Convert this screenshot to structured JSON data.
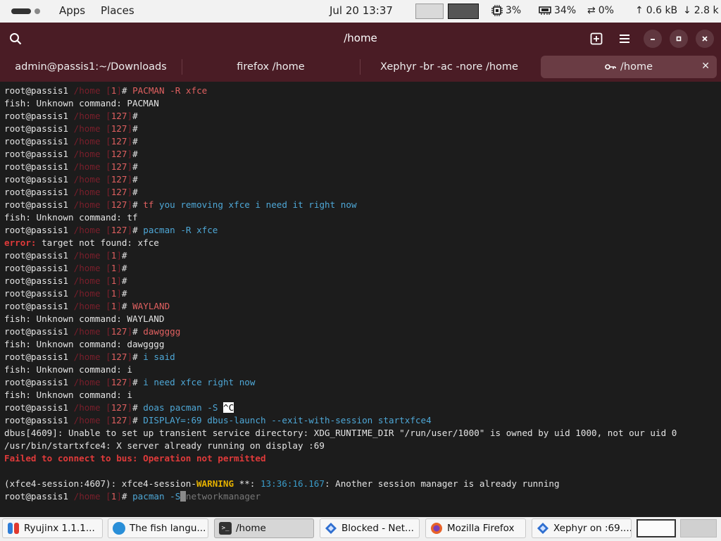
{
  "top_panel": {
    "apps_label": "Apps",
    "places_label": "Places",
    "clock": "Jul 20  13:37",
    "cpu": "3%",
    "mem": "34%",
    "swap": "0%",
    "net_up": "0.6 kB",
    "net_down": "2.8 k"
  },
  "window": {
    "title": "/home",
    "tabs": [
      {
        "label": "admin@passis1:~/Downloads"
      },
      {
        "label": "firefox /home"
      },
      {
        "label": "Xephyr -br -ac -nore /home"
      },
      {
        "label": "/home"
      }
    ]
  },
  "terminal": {
    "user": "root",
    "host": "@passis1",
    "cwd": "/home",
    "lines": [
      {
        "status": "1",
        "cmd": "PACMAN -R xfce"
      },
      {
        "out": "fish: Unknown command: PACMAN"
      },
      {
        "status": "127",
        "cmd": ""
      },
      {
        "status": "127",
        "cmd": ""
      },
      {
        "status": "127",
        "cmd": ""
      },
      {
        "status": "127",
        "cmd": ""
      },
      {
        "status": "127",
        "cmd": ""
      },
      {
        "status": "127",
        "cmd": ""
      },
      {
        "status": "127",
        "cmd": ""
      },
      {
        "status": "127",
        "cmd_word": "tf",
        "cmd_rest": " you removing xfce i need it right now"
      },
      {
        "out": "fish: Unknown command: tf"
      },
      {
        "status": "127",
        "cmd_word": "pacman",
        "cmd_rest": " -R xfce"
      },
      {
        "err_label": "error:",
        "out": " target not found: xfce"
      },
      {
        "status": "1",
        "cmd": ""
      },
      {
        "status": "1",
        "cmd": ""
      },
      {
        "status": "1",
        "cmd": ""
      },
      {
        "status": "1",
        "cmd": ""
      },
      {
        "status": "1",
        "cmd": "WAYLAND"
      },
      {
        "out": "fish: Unknown command: WAYLAND"
      },
      {
        "status": "127",
        "cmd": "dawgggg"
      },
      {
        "out": "fish: Unknown command: dawgggg"
      },
      {
        "status": "127",
        "cmd_word": "i",
        "cmd_rest": " said"
      },
      {
        "out": "fish: Unknown command: i"
      },
      {
        "status": "127",
        "cmd_word": "i",
        "cmd_rest": " need xfce right now"
      },
      {
        "out": "fish: Unknown command: i"
      },
      {
        "status": "127",
        "cmd_word": "doas",
        "cmd_rest": " pacman -S ",
        "ctrl": "^C"
      },
      {
        "status": "127",
        "cmd_word": "DISPLAY=:69",
        "cmd_rest": " dbus-launch --exit-with-session startxfce4"
      },
      {
        "out": "dbus[4609]: Unable to set up transient service directory: XDG_RUNTIME_DIR \"/run/user/1000\" is owned by uid 1000, not our uid 0"
      },
      {
        "out": "/usr/bin/startxfce4: X server already running on display :69"
      },
      {
        "fatal": "Failed to connect to bus: Operation not permitted"
      },
      {
        "out": ""
      },
      {
        "warn_pre": "(xfce4-session:4607): xfce4-session-",
        "warn": "WARNING",
        "warn_mid": " **: ",
        "warn_ts": "13:36:16.167",
        "warn_post": ": Another session manager is already running"
      },
      {
        "status": "1",
        "cmd_word": "pacman",
        "cmd_rest": " -S",
        "suggestion": "networkmanager"
      }
    ]
  },
  "taskbar": {
    "items": [
      {
        "label": "Ryujinx 1.1.1...",
        "icon": "ryujinx-icon",
        "color": "#2e7dd7"
      },
      {
        "label": "The fish langu...",
        "icon": "globe-icon",
        "color": "#2a8fd8"
      },
      {
        "label": "/home",
        "icon": "terminal-icon",
        "color": "#333333",
        "active": true
      },
      {
        "label": "Blocked - Net...",
        "icon": "app-diamond-icon",
        "color": "#2f6fd0"
      },
      {
        "label": "Mozilla Firefox",
        "icon": "firefox-icon",
        "color": "#e8632a"
      },
      {
        "label": "Xephyr on :69....",
        "icon": "app-diamond-icon",
        "color": "#2f6fd0"
      }
    ]
  },
  "colors": {
    "headerbar": "#4a1c25",
    "prompt_red": "#e06060",
    "cmd_blue": "#4ea7d6",
    "error_red": "#e03a3a",
    "warning_yellow": "#e5b100"
  }
}
